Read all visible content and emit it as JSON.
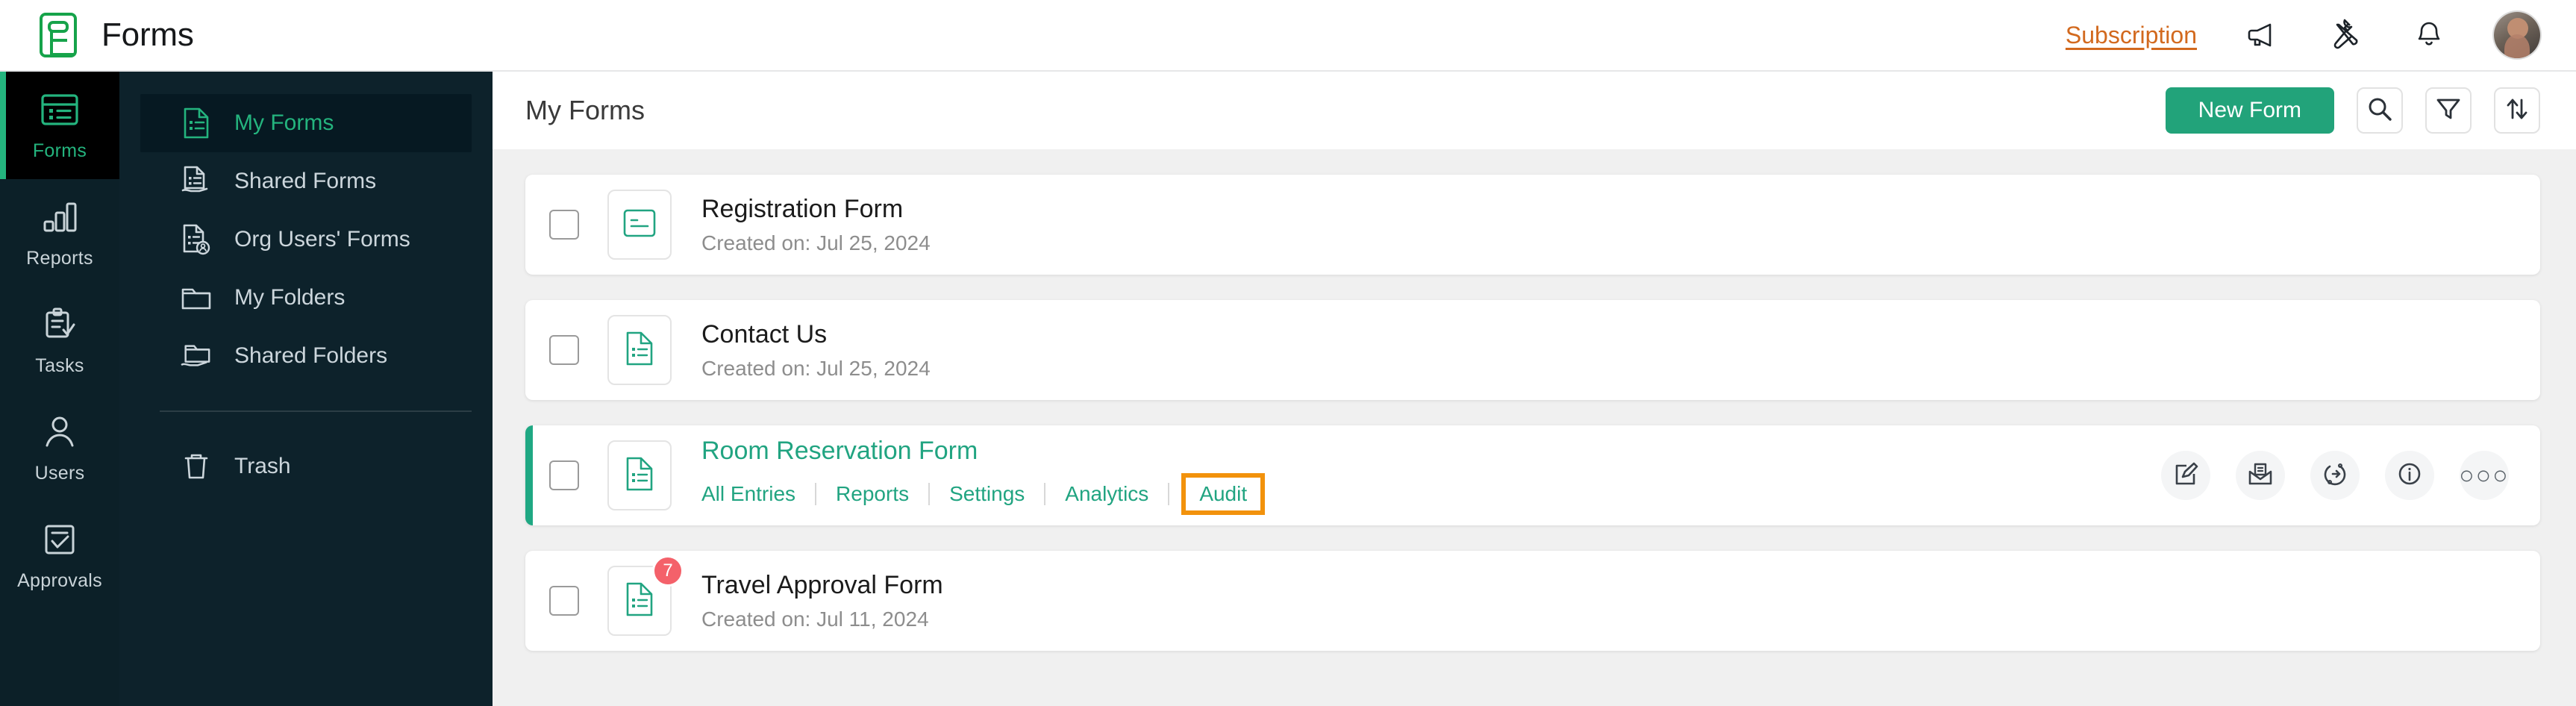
{
  "header": {
    "brand": "Forms",
    "brand_logo_icon": "forms-logo-icon",
    "subscription_label": "Subscription",
    "icons": [
      {
        "name": "megaphone-icon",
        "label": "Announcements"
      },
      {
        "name": "tools-icon",
        "label": "Tools"
      },
      {
        "name": "bell-icon",
        "label": "Notifications"
      }
    ],
    "avatar_name": "user-avatar"
  },
  "rail": {
    "items": [
      {
        "label": "Forms",
        "icon": "forms-icon",
        "active": true
      },
      {
        "label": "Reports",
        "icon": "reports-bar-chart-icon",
        "active": false
      },
      {
        "label": "Tasks",
        "icon": "tasks-clipboard-check-icon",
        "active": false
      },
      {
        "label": "Users",
        "icon": "users-person-icon",
        "active": false
      },
      {
        "label": "Approvals",
        "icon": "approvals-check-square-icon",
        "active": false
      }
    ]
  },
  "subnav": {
    "items": [
      {
        "label": "My Forms",
        "icon": "document-list-icon",
        "active": true
      },
      {
        "label": "Shared Forms",
        "icon": "shared-document-icon",
        "active": false
      },
      {
        "label": "Org Users' Forms",
        "icon": "org-users-document-icon",
        "active": false
      },
      {
        "label": "My Folders",
        "icon": "folder-icon",
        "active": false
      },
      {
        "label": "Shared Folders",
        "icon": "shared-folder-icon",
        "active": false
      }
    ],
    "trash": {
      "label": "Trash",
      "icon": "trash-icon"
    }
  },
  "main": {
    "title": "My Forms",
    "new_form_label": "New Form",
    "toolbar_icons": [
      {
        "name": "search-icon"
      },
      {
        "name": "filter-icon"
      },
      {
        "name": "sort-icon"
      }
    ],
    "rows": [
      {
        "title": "Registration Form",
        "subtitle": "Created on: Jul 25, 2024",
        "thumb_icon": "form-card-icon",
        "highlighted": false,
        "badge": null,
        "links": []
      },
      {
        "title": "Contact Us",
        "subtitle": "Created on: Jul 25, 2024",
        "thumb_icon": "document-list-icon",
        "highlighted": false,
        "badge": null,
        "links": []
      },
      {
        "title": "Room Reservation Form",
        "subtitle": "",
        "thumb_icon": "document-list-icon",
        "highlighted": true,
        "badge": null,
        "links": [
          {
            "label": "All Entries",
            "boxed": false
          },
          {
            "label": "Reports",
            "boxed": false
          },
          {
            "label": "Settings",
            "boxed": false
          },
          {
            "label": "Analytics",
            "boxed": false
          },
          {
            "label": "Audit",
            "boxed": true
          }
        ],
        "actions": [
          {
            "name": "edit-form-icon"
          },
          {
            "name": "share-mail-icon"
          },
          {
            "name": "integrations-icon"
          },
          {
            "name": "info-icon"
          },
          {
            "name": "more-options-icon",
            "glyph": "○○○"
          }
        ]
      },
      {
        "title": "Travel Approval Form",
        "subtitle": "Created on: Jul 11, 2024",
        "thumb_icon": "document-list-icon",
        "highlighted": false,
        "badge": "7",
        "links": []
      }
    ]
  },
  "colors": {
    "accent_green": "#21a481",
    "brand_green": "#22a37a",
    "highlight_orange": "#f2920c",
    "subscription_orange": "#d2691e",
    "badge_red": "#f4616a",
    "rail_bg": "#0c2028",
    "subnav_bg": "#0d222b",
    "content_bg": "#f0f0f0"
  }
}
